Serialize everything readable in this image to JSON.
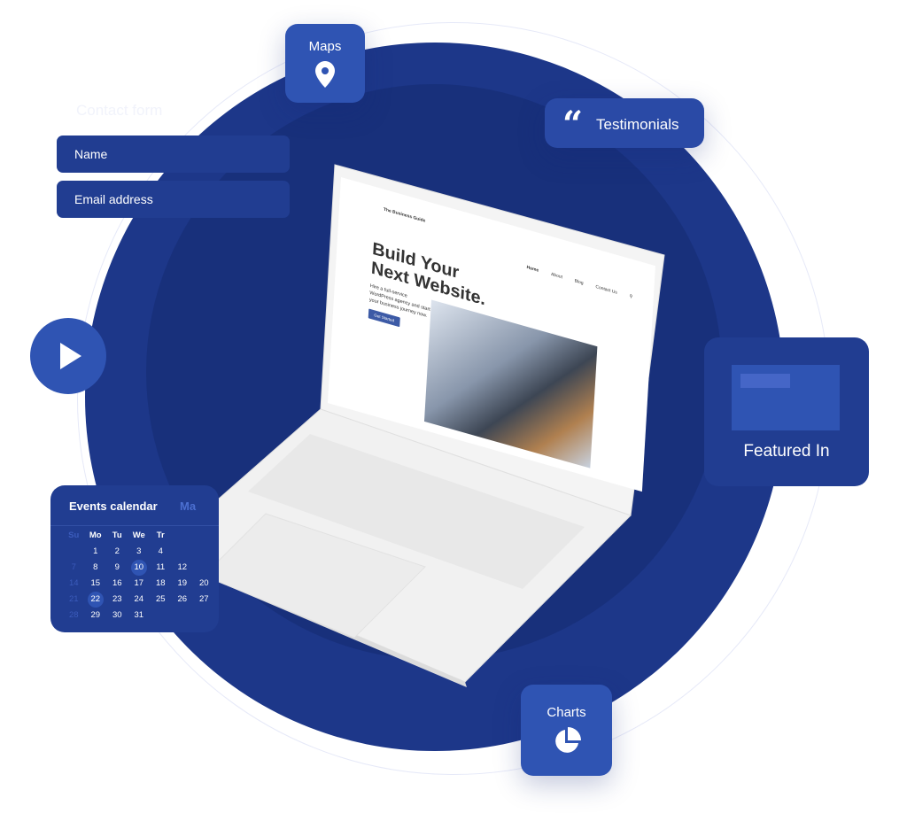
{
  "contact_form": {
    "title": "Contact form",
    "name_placeholder": "Name",
    "email_placeholder": "Email address"
  },
  "maps": {
    "label": "Maps",
    "icon": "map-pin-icon"
  },
  "testimonials": {
    "label": "Testimonials",
    "icon": "quote-icon"
  },
  "video": {
    "icon": "play-icon"
  },
  "featured": {
    "label": "Featured In"
  },
  "charts": {
    "label": "Charts",
    "icon": "pie-chart-icon"
  },
  "calendar": {
    "title": "Events calendar",
    "next_month": "Ma",
    "weekdays": [
      "Su",
      "Mo",
      "Tu",
      "We",
      "Tr"
    ],
    "weeks": [
      [
        "",
        "1",
        "2",
        "3",
        "4"
      ],
      [
        "7",
        "8",
        "9",
        "10",
        "11",
        "12",
        ""
      ],
      [
        "14",
        "15",
        "16",
        "17",
        "18",
        "19",
        "20"
      ],
      [
        "21",
        "22",
        "23",
        "24",
        "25",
        "26",
        "27"
      ],
      [
        "28",
        "29",
        "30",
        "31"
      ]
    ],
    "highlighted": [
      "10",
      "22"
    ]
  },
  "website": {
    "brand": "The Business Guide",
    "nav": [
      "Home",
      "About",
      "Blog",
      "Contact Us"
    ],
    "headline_1": "Build Your",
    "headline_2": "Next Website.",
    "body": "Hire a full-service WordPress agency and start your business journey now.",
    "cta": "Get Started"
  },
  "colors": {
    "primary": "#1d3789",
    "accent": "#2f54b3"
  }
}
